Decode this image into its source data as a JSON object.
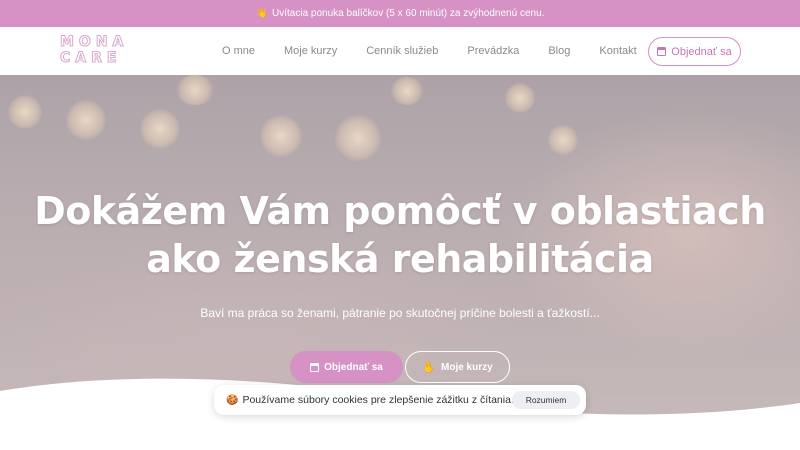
{
  "promo": {
    "icon": "waving-hand-icon",
    "text": "Uvítacia ponuka balíčkov (5 x 60 minút) za zvýhodnenú cenu."
  },
  "header": {
    "logo_line1": "MONA",
    "logo_line2": "CARE",
    "nav": [
      "O mne",
      "Moje kurzy",
      "Cenník služieb",
      "Prevádzka",
      "Blog",
      "Kontakt"
    ],
    "cta_label": "Objednať sa",
    "cta_icon": "calendar-icon"
  },
  "hero": {
    "title_line1": "Dokážem Vám pomôcť v oblastiach",
    "title_line2": "ako ženská rehabilitácia",
    "subtitle": "Baví ma práca so ženami, pátranie po skutočnej príčine bolesti a ťažkostí...",
    "primary_button": "Objednať sa",
    "secondary_button": "Moje kurzy"
  },
  "cookie": {
    "icon": "cookie-icon",
    "text": "Používame súbory cookies pre zlepšenie zážitku z čítania.",
    "button": "Rozumiem"
  },
  "colors": {
    "accent": "#d691c5",
    "promo_bg": "#d691c5"
  }
}
